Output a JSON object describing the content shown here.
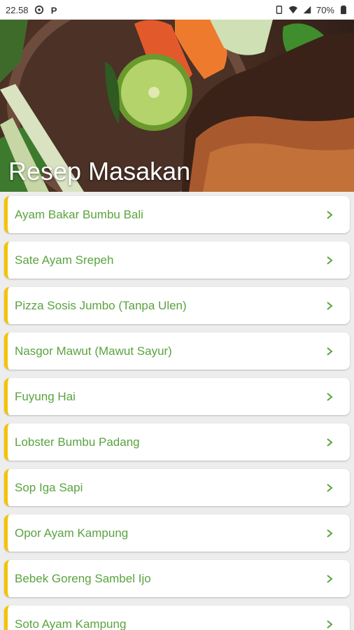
{
  "status_bar": {
    "time": "22.58",
    "battery": "70%",
    "icons": [
      "sync-icon",
      "parking-icon",
      "vibrate-icon",
      "wifi-icon",
      "signal-icon",
      "battery-icon"
    ]
  },
  "header": {
    "title": "Resep Masakan"
  },
  "recipes": [
    {
      "label": "Ayam Bakar Bumbu Bali"
    },
    {
      "label": "Sate Ayam Srepeh"
    },
    {
      "label": "Pizza Sosis Jumbo (Tanpa Ulen)"
    },
    {
      "label": "Nasgor Mawut (Mawut Sayur)"
    },
    {
      "label": "Fuyung Hai"
    },
    {
      "label": "Lobster Bumbu Padang"
    },
    {
      "label": "Sop Iga Sapi"
    },
    {
      "label": "Opor Ayam Kampung"
    },
    {
      "label": "Bebek Goreng Sambel Ijo"
    },
    {
      "label": "Soto Ayam Kampung"
    }
  ],
  "colors": {
    "accent_bar": "#f3c300",
    "label_text": "#5aa33f",
    "chevron": "#5aa33f",
    "background": "#ededed"
  }
}
